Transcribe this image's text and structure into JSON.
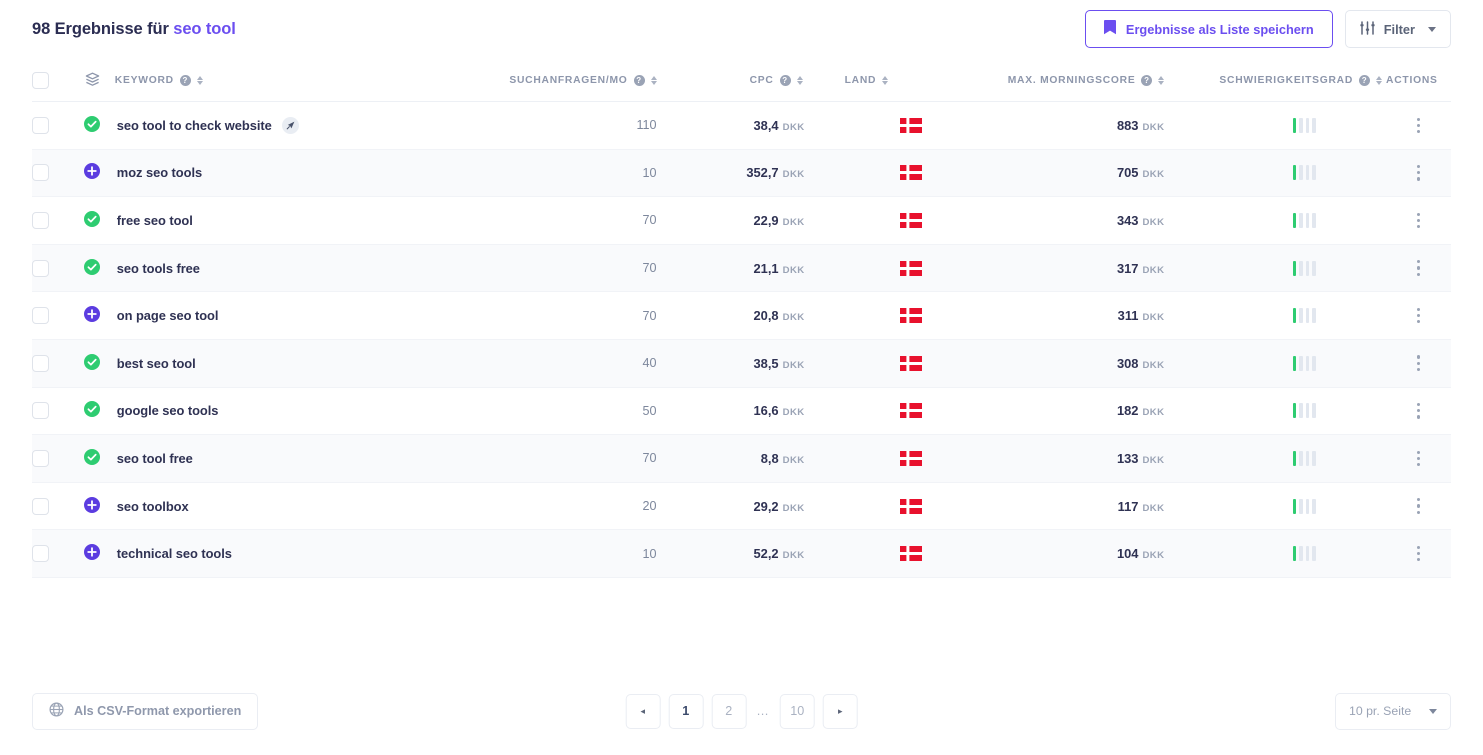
{
  "header": {
    "results_count_text": "98 Ergebnisse für",
    "keyword": "seo tool",
    "save_list_label": "Ergebnisse als Liste speichern",
    "filter_label": "Filter"
  },
  "table": {
    "columns": {
      "keyword": "KEYWORD",
      "volume": "SUCHANFRAGEN/MO",
      "cpc": "CPC",
      "country": "LAND",
      "score": "MAX. MORNINGSCORE",
      "difficulty": "SCHWIERIGKEITSGRAD",
      "actions": "ACTIONS"
    },
    "currency": "DKK",
    "rows": [
      {
        "status": "tracked",
        "keyword": "seo tool to check website",
        "badge": "rocket",
        "volume": "110",
        "cpc": "38,4",
        "country": "DK",
        "score": "883",
        "difficulty": 1,
        "difficulty_max": 4
      },
      {
        "status": "add",
        "keyword": "moz seo tools",
        "badge": "",
        "volume": "10",
        "cpc": "352,7",
        "country": "DK",
        "score": "705",
        "difficulty": 1,
        "difficulty_max": 4
      },
      {
        "status": "tracked",
        "keyword": "free seo tool",
        "badge": "",
        "volume": "70",
        "cpc": "22,9",
        "country": "DK",
        "score": "343",
        "difficulty": 1,
        "difficulty_max": 4
      },
      {
        "status": "tracked",
        "keyword": "seo tools free",
        "badge": "",
        "volume": "70",
        "cpc": "21,1",
        "country": "DK",
        "score": "317",
        "difficulty": 1,
        "difficulty_max": 4
      },
      {
        "status": "add",
        "keyword": "on page seo tool",
        "badge": "",
        "volume": "70",
        "cpc": "20,8",
        "country": "DK",
        "score": "311",
        "difficulty": 1,
        "difficulty_max": 4
      },
      {
        "status": "tracked",
        "keyword": "best seo tool",
        "badge": "",
        "volume": "40",
        "cpc": "38,5",
        "country": "DK",
        "score": "308",
        "difficulty": 1,
        "difficulty_max": 4
      },
      {
        "status": "tracked",
        "keyword": "google seo tools",
        "badge": "",
        "volume": "50",
        "cpc": "16,6",
        "country": "DK",
        "score": "182",
        "difficulty": 1,
        "difficulty_max": 4
      },
      {
        "status": "tracked",
        "keyword": "seo tool free",
        "badge": "",
        "volume": "70",
        "cpc": "8,8",
        "country": "DK",
        "score": "133",
        "difficulty": 1,
        "difficulty_max": 4
      },
      {
        "status": "add",
        "keyword": "seo toolbox",
        "badge": "",
        "volume": "20",
        "cpc": "29,2",
        "country": "DK",
        "score": "117",
        "difficulty": 1,
        "difficulty_max": 4
      },
      {
        "status": "add",
        "keyword": "technical seo tools",
        "badge": "",
        "volume": "10",
        "cpc": "52,2",
        "country": "DK",
        "score": "104",
        "difficulty": 1,
        "difficulty_max": 4
      }
    ]
  },
  "footer": {
    "export_label": "Als CSV-Format exportieren",
    "pagination": {
      "prev": "◂",
      "next": "▸",
      "pages": [
        "1",
        "2",
        "…",
        "10"
      ],
      "active": "1"
    },
    "per_page_label": "10 pr. Seite"
  },
  "colors": {
    "accent": "#6b4ef0",
    "success": "#2ecc71",
    "text": "#2f3253",
    "muted": "#8d96ab",
    "flag_red": "#e8112d"
  }
}
